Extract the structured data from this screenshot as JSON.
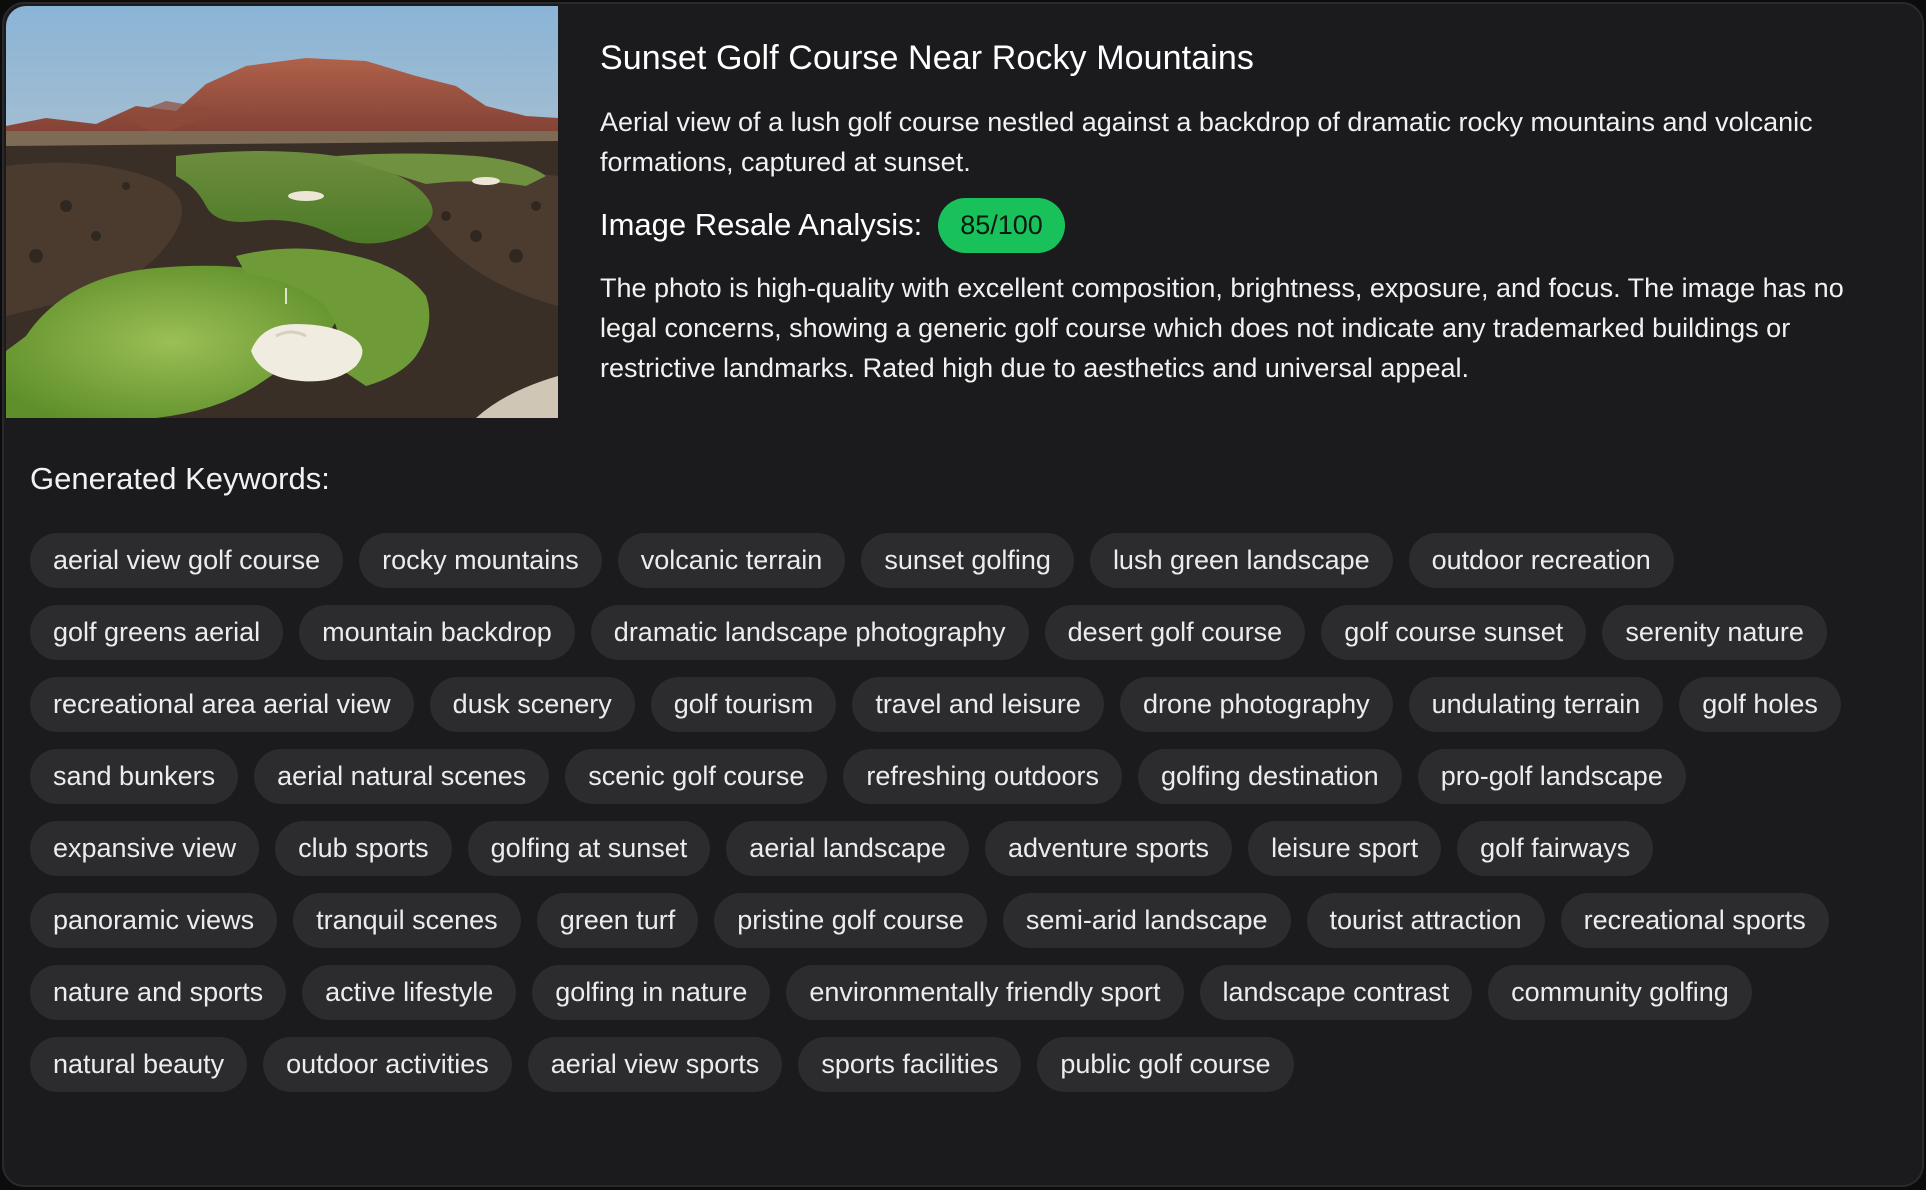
{
  "image": {
    "alt_icon": "golf-course-photo"
  },
  "header": {
    "title": "Sunset Golf Course Near Rocky Mountains",
    "description": "Aerial view of a lush golf course nestled against a backdrop of dramatic rocky mountains and volcanic formations, captured at sunset."
  },
  "resale": {
    "label": "Image Resale Analysis:",
    "score": "85/100",
    "score_value": 85,
    "score_color": "#19c15a",
    "analysis": "The photo is high-quality with excellent composition, brightness, exposure, and focus. The image has no legal concerns, showing a generic golf course which does not indicate any trademarked buildings or restrictive landmarks. Rated high due to aesthetics and universal appeal."
  },
  "keywords": {
    "title": "Generated Keywords:",
    "items": [
      "aerial view golf course",
      "rocky mountains",
      "volcanic terrain",
      "sunset golfing",
      "lush green landscape",
      "outdoor recreation",
      "golf greens aerial",
      "mountain backdrop",
      "dramatic landscape photography",
      "desert golf course",
      "golf course sunset",
      "serenity nature",
      "recreational area aerial view",
      "dusk scenery",
      "golf tourism",
      "travel and leisure",
      "drone photography",
      "undulating terrain",
      "golf holes",
      "sand bunkers",
      "aerial natural scenes",
      "scenic golf course",
      "refreshing outdoors",
      "golfing destination",
      "pro-golf landscape",
      "expansive view",
      "club sports",
      "golfing at sunset",
      "aerial landscape",
      "adventure sports",
      "leisure sport",
      "golf fairways",
      "panoramic views",
      "tranquil scenes",
      "green turf",
      "pristine golf course",
      "semi-arid landscape",
      "tourist attraction",
      "recreational sports",
      "nature and sports",
      "active lifestyle",
      "golfing in nature",
      "environmentally friendly sport",
      "landscape contrast",
      "community golfing",
      "natural beauty",
      "outdoor activities",
      "aerial view sports",
      "sports facilities",
      "public golf course"
    ]
  },
  "colors": {
    "card_bg": "#1b1b1d",
    "chip_bg": "#2c2c2f",
    "accent_green": "#19c15a"
  }
}
